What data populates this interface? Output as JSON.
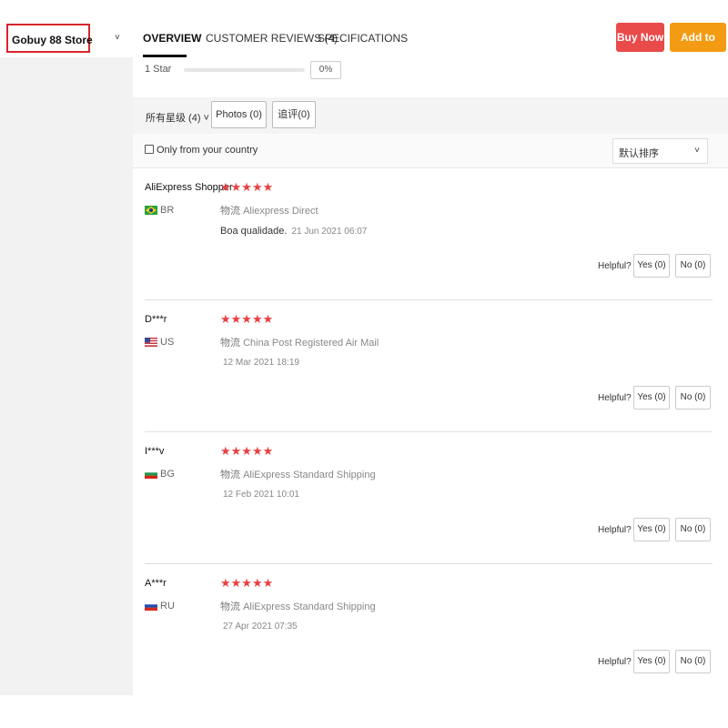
{
  "store": {
    "name": "Gobuy 88 Store",
    "chevron": "˅"
  },
  "tabs": [
    {
      "label": "OVERVIEW",
      "active": true
    },
    {
      "label": "CUSTOMER REVIEWS (4)",
      "active": false
    },
    {
      "label": "SPECIFICATIONS",
      "active": false
    }
  ],
  "actions": {
    "buy_now": "Buy Now",
    "add_to_cart": "Add to Cart"
  },
  "rating": {
    "label": "1 Star",
    "percent": "0%",
    "fill": 0
  },
  "filters": {
    "all": "所有星级 (4) ˅",
    "photos": "Photos (0)",
    "followups": "追评(0)",
    "country_only": "Only from your country",
    "sort": "默认排序",
    "sort_chevron": "˅"
  },
  "reviews": [
    {
      "name": "AliExpress Shopper",
      "country": "BR",
      "flag": "brazil-flag-icon",
      "stars": "★★★★★",
      "logistics_label": "物流",
      "logistics": "Aliexpress Direct",
      "text": "Boa qualidade.",
      "date": "21 Jun 2021 06:07",
      "helpful": "Helpful?",
      "yes": "Yes (0)",
      "no": "No (0)"
    },
    {
      "name": "D***r",
      "country": "US",
      "flag": "usa-flag-icon",
      "stars": "★★★★★",
      "logistics_label": "物流",
      "logistics": "China Post Registered Air Mail",
      "text": "",
      "date": "12 Mar 2021 18:19",
      "helpful": "Helpful?",
      "yes": "Yes (0)",
      "no": "No (0)"
    },
    {
      "name": "I***v",
      "country": "BG",
      "flag": "bulgaria-flag-icon",
      "stars": "★★★★★",
      "logistics_label": "物流",
      "logistics": "AliExpress Standard Shipping",
      "text": "",
      "date": "12 Feb 2021 10:01",
      "helpful": "Helpful?",
      "yes": "Yes (0)",
      "no": "No (0)"
    },
    {
      "name": "A***r",
      "country": "RU",
      "flag": "russia-flag-icon",
      "stars": "★★★★★",
      "logistics_label": "物流",
      "logistics": "AliExpress Standard Shipping",
      "text": "",
      "date": "27 Apr 2021 07:35",
      "helpful": "Helpful?",
      "yes": "Yes (0)",
      "no": "No (0)"
    }
  ],
  "colors": {
    "buy_now": "#e94a4a",
    "add_to_cart": "#f39b12",
    "stars": "#e84040",
    "highlight_border": "#d8252c"
  }
}
